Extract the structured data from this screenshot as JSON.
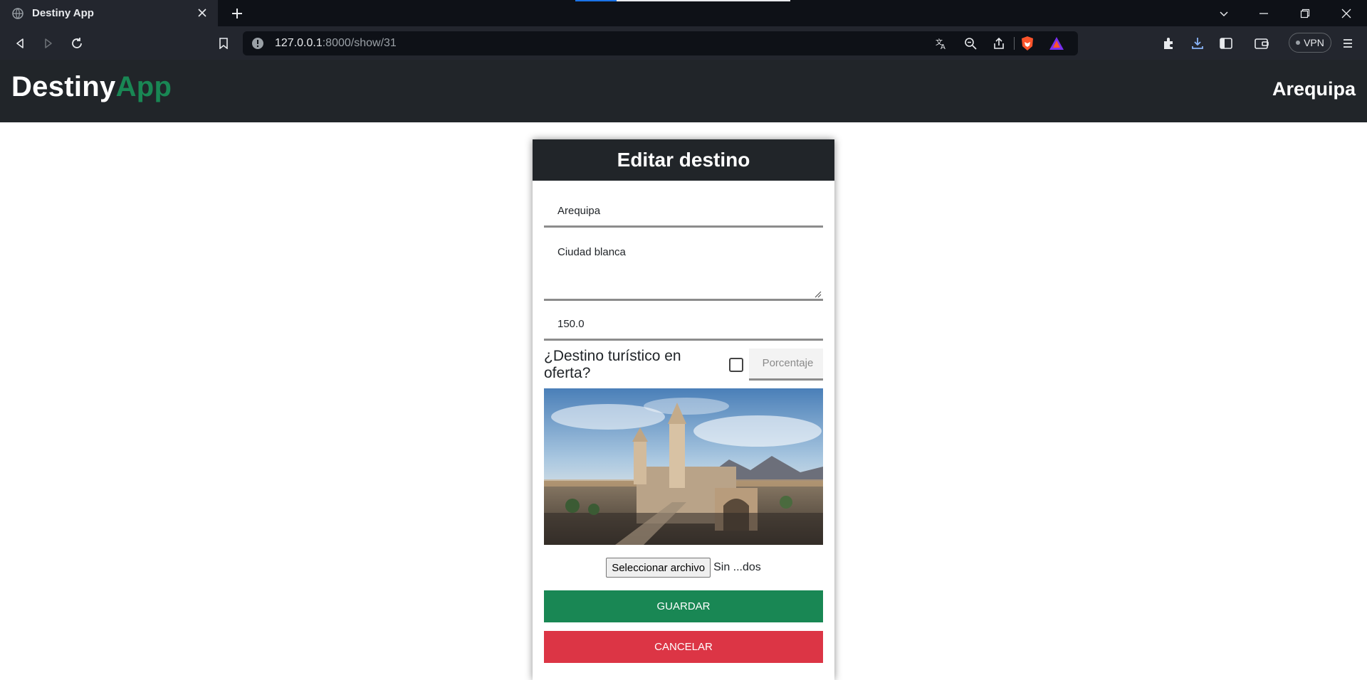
{
  "browser": {
    "tab_title": "Destiny App",
    "url_host": "127.0.0.1",
    "url_rest": ":8000/show/31",
    "vpn_label": "VPN",
    "icons": [
      "globe-icon",
      "close-icon",
      "plus-icon",
      "back-icon",
      "forward-icon",
      "reload-icon",
      "bookmark-icon",
      "info-icon",
      "translate-icon",
      "zoom-icon",
      "share-icon",
      "brave-shield-icon",
      "rewards-icon",
      "extensions-icon",
      "download-icon",
      "sidebar-icon",
      "wallet-icon",
      "menu-icon",
      "minimize-icon",
      "restore-icon",
      "window-close-icon",
      "tab-search-icon"
    ]
  },
  "navbar": {
    "brand_main": "Destiny",
    "brand_accent": "App",
    "city": "Arequipa"
  },
  "form": {
    "header": "Editar destino",
    "name_value": "Arequipa",
    "description_value": "Ciudad blanca",
    "price_value": "150.0",
    "offer_label": "¿Destino turístico en oferta?",
    "offer_checked": false,
    "percent_placeholder": "Porcentaje",
    "file_button": "Seleccionar archivo",
    "file_status": "Sin ...dos",
    "save_label": "GUARDAR",
    "cancel_label": "CANCELAR"
  },
  "colors": {
    "accent_green": "#198754",
    "danger_red": "#dc3545",
    "navbar_dark": "#212529"
  }
}
